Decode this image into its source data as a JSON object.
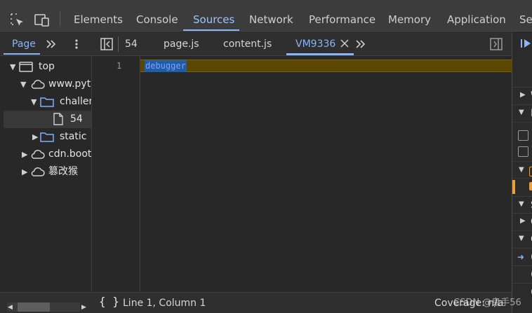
{
  "toolbar": {
    "tabs": [
      "Elements",
      "Console",
      "Sources",
      "Network",
      "Performance",
      "Memory",
      "Application",
      "Sec"
    ]
  },
  "navigator": {
    "tab_page": "Page",
    "tree": [
      {
        "label": "top"
      },
      {
        "label": "www.pyth"
      },
      {
        "label": "challen"
      },
      {
        "label": "54"
      },
      {
        "label": "static"
      },
      {
        "label": "cdn.boots"
      },
      {
        "label": "篡改猴"
      }
    ]
  },
  "editor": {
    "tabs": [
      "54",
      "page.js",
      "content.js",
      "VM9336"
    ],
    "active_tab": "VM9336",
    "line_number": "1",
    "code": "debugger"
  },
  "status": {
    "position": "Line 1, Column 1",
    "coverage": "Coverage: n/a",
    "watermark": "CSDN @鬼手56"
  },
  "right_panel": {
    "rows": [
      "W",
      "B",
      "",
      "",
      "",
      "",
      "S",
      "C",
      "C",
      "(",
      "(",
      "("
    ]
  },
  "colors": {
    "accent": "#8ab4f8",
    "paused_line": "#5b4800",
    "warning": "#f0a030"
  }
}
